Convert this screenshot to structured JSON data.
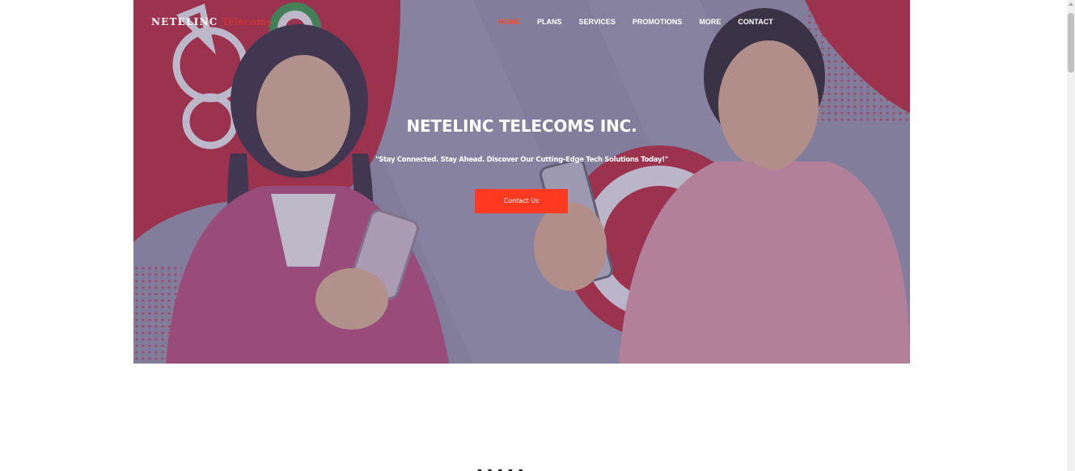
{
  "brand": {
    "main": "NETELINC",
    "accent": "Telecoms"
  },
  "nav": {
    "items": [
      "HOME",
      "PLANS",
      "SERVICES",
      "PROMOTIONS",
      "MORE",
      "CONTACT"
    ],
    "active_index": 0
  },
  "hero": {
    "title": "NETELINC TELECOMS INC.",
    "tagline": "\"Stay Connected. Stay Ahead. Discover Our Cutting-Edge Tech Solutions Today!\"",
    "cta_label": "Contact Us"
  },
  "next_section": {
    "heading_partial": "- -  - - -"
  },
  "colors": {
    "accent": "#ff3a20",
    "active_nav": "#ff4a2a",
    "brand_red": "#e0342b",
    "hero_tint": "#7d7a92"
  },
  "icons": {
    "scrollbar_up": "chevron-up-icon"
  }
}
